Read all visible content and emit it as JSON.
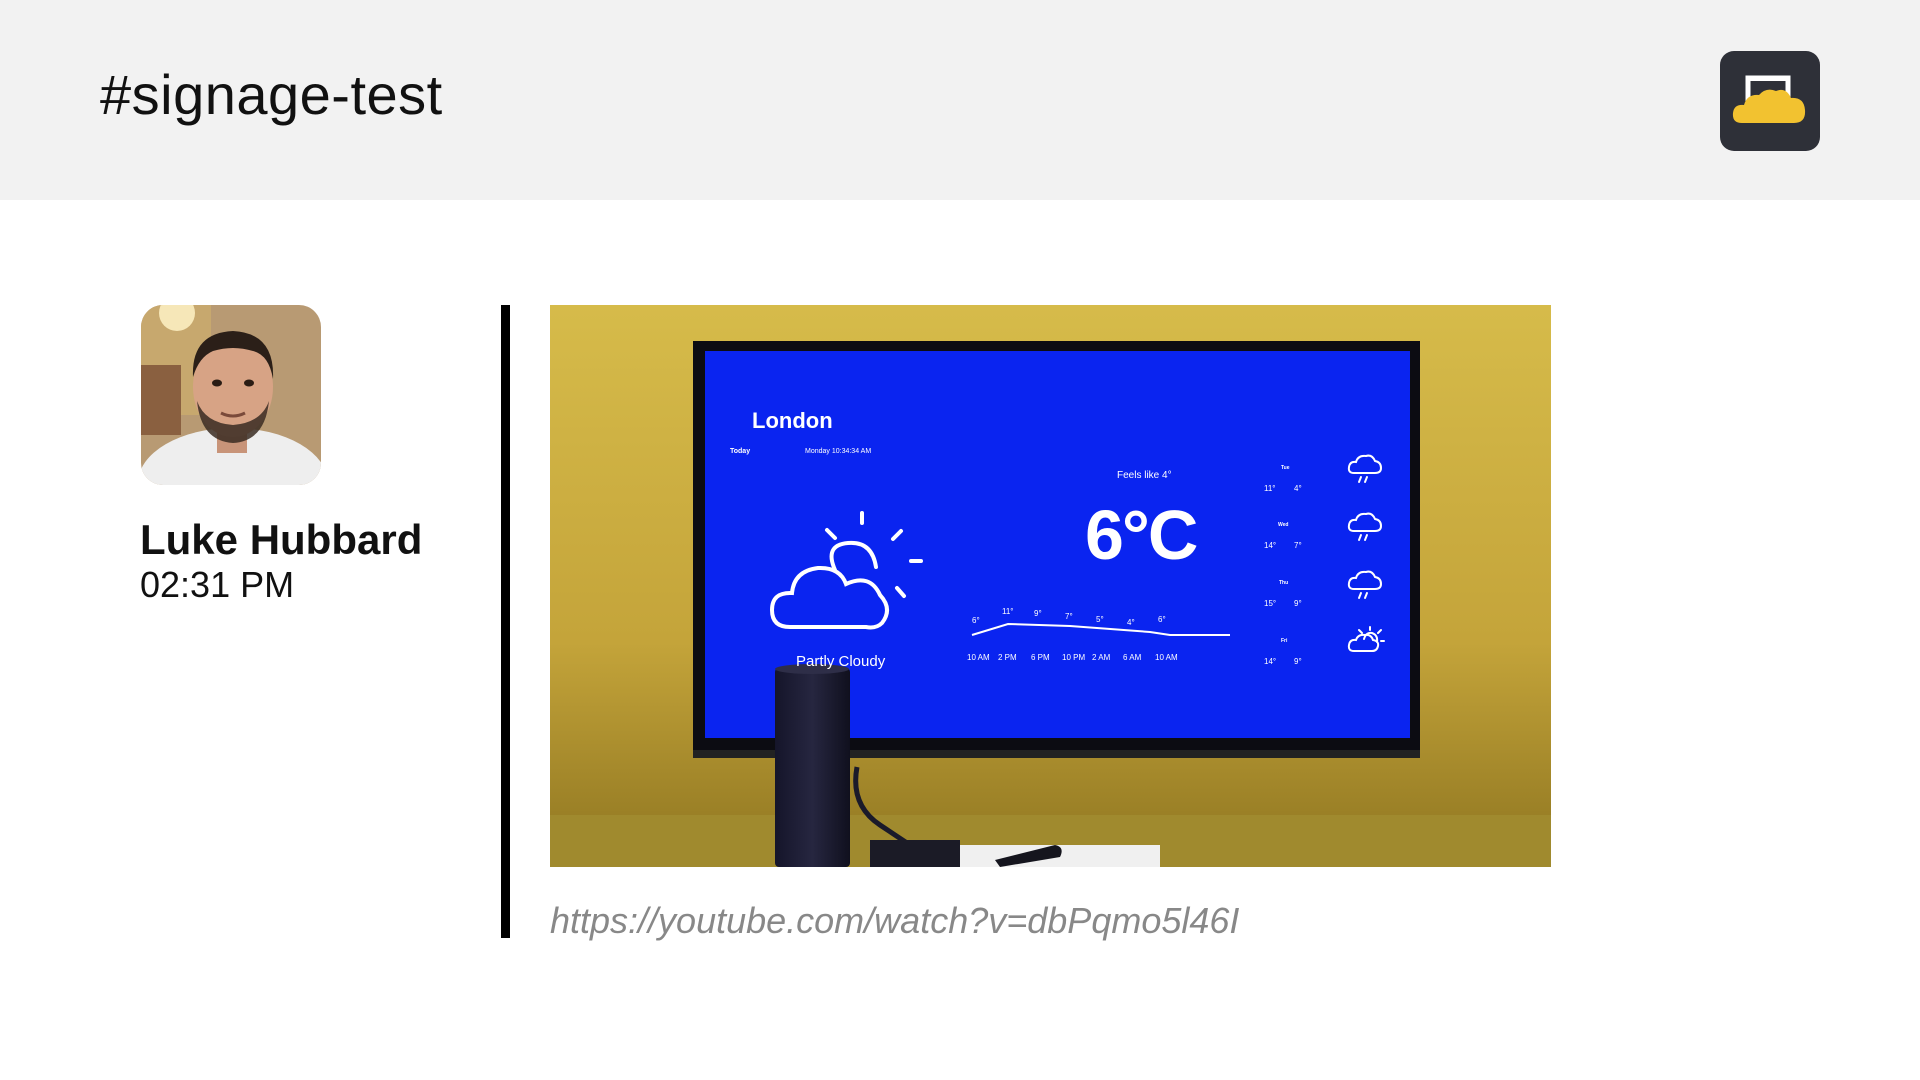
{
  "header": {
    "channel": "#signage-test",
    "logo_icon": "signage-cloud-logo-icon"
  },
  "message": {
    "author": "Luke Hubbard",
    "time": "02:31 PM",
    "avatar_icon": "user-avatar",
    "link": "https://youtube.com/watch?v=dbPqmo5l46I"
  },
  "tv": {
    "city": "London",
    "tab_today": "Today",
    "datetime": "Monday 10:34:34 AM",
    "feels_like": "Feels like 4°",
    "temperature": "6°C",
    "condition": "Partly Cloudy",
    "hourly": [
      {
        "temp": "6°",
        "time": "10 AM"
      },
      {
        "temp": "11°",
        "time": "2 PM"
      },
      {
        "temp": "9°",
        "time": "6 PM"
      },
      {
        "temp": "7°",
        "time": "10 PM"
      },
      {
        "temp": "5°",
        "time": "2 AM"
      },
      {
        "temp": "4°",
        "time": "6 AM"
      },
      {
        "temp": "6°",
        "time": "10 AM"
      }
    ],
    "daily": [
      {
        "day": "Tue",
        "high": "11°",
        "low": "4°",
        "icon": "rain-cloud-icon"
      },
      {
        "day": "Wed",
        "high": "14°",
        "low": "7°",
        "icon": "rain-cloud-icon"
      },
      {
        "day": "Thu",
        "high": "15°",
        "low": "9°",
        "icon": "rain-cloud-icon"
      },
      {
        "day": "Fri",
        "high": "14°",
        "low": "9°",
        "icon": "partly-cloudy-icon"
      }
    ]
  },
  "colors": {
    "header_bg": "#f2f2f2",
    "wall": "#c9ac3a",
    "tv_screen": "#0a24f0",
    "logo_bg": "#2e3038",
    "logo_cloud": "#f2c230",
    "link": "#888888"
  }
}
